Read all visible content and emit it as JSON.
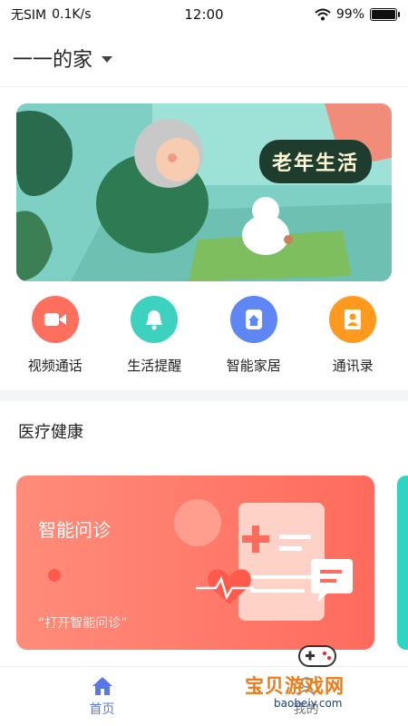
{
  "status_bar": {
    "carrier": "无SIM",
    "speed": "0.1K/s",
    "time": "12:00",
    "battery": "99%",
    "battery_level": 0.99,
    "wifi_icon": "wifi-icon"
  },
  "header": {
    "title": "一一的家",
    "dropdown_icon": "chevron-down-icon"
  },
  "banner": {
    "badge_text": "老年生活"
  },
  "actions": [
    {
      "label": "视频通话",
      "icon": "video-call-icon",
      "color": "#ff6f5e"
    },
    {
      "label": "生活提醒",
      "icon": "bell-icon",
      "color": "#3dd1c0"
    },
    {
      "label": "智能家居",
      "icon": "smart-home-icon",
      "color": "#5f86f5"
    },
    {
      "label": "通讯录",
      "icon": "contacts-icon",
      "color": "#ff9a1f"
    }
  ],
  "section": {
    "title": "医疗健康"
  },
  "card": {
    "title": "智能问诊",
    "subtitle": "“打开智能问诊”"
  },
  "bottom_nav": {
    "home_label": "首页",
    "second_label": "我的",
    "active_color": "#5b78e6"
  },
  "watermark": {
    "text": "宝贝游戏网",
    "url": "baobeiy.com"
  }
}
